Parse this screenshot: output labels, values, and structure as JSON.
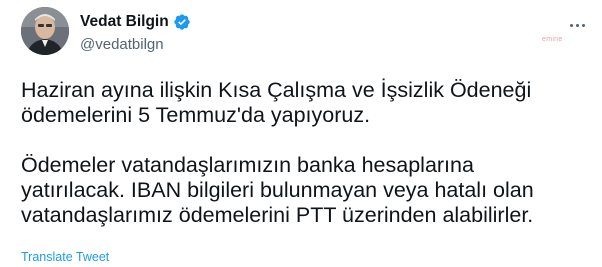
{
  "author": {
    "display_name": "Vedat Bilgin",
    "handle": "@vedatbilgn",
    "verified": true
  },
  "watermark": "emine",
  "tweet": {
    "paragraph1": [
      "Haziran ayına ilişkin Kısa Çalışma ve İşsizlik Ödeneği",
      "ödemelerini 5 Temmuz'da yapıyoruz."
    ],
    "paragraph2": [
      "Ödemeler vatandaşlarımızın banka hesaplarına",
      "yatırılacak. IBAN bilgileri bulunmayan veya hatalı olan",
      "vatandaşlarımız ödemelerini PTT üzerinden alabilirler."
    ]
  },
  "actions": {
    "translate_label": "Translate Tweet"
  },
  "colors": {
    "text": "#0f1419",
    "secondary": "#536471",
    "link": "#1d9bf0",
    "verified": "#1d9bf0"
  },
  "icons": {
    "verified": "verified-badge-icon",
    "more": "more-options-icon"
  }
}
